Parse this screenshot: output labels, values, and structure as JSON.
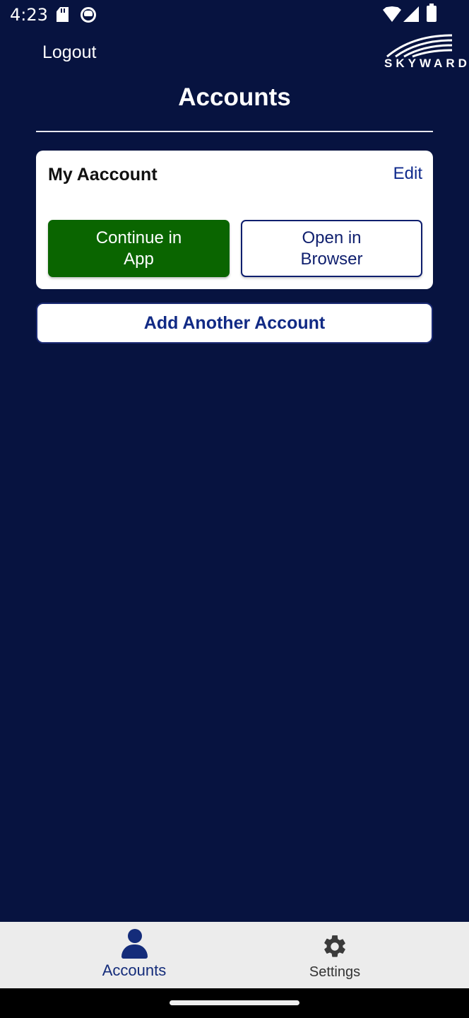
{
  "status_bar": {
    "time": "4:23",
    "icons": [
      "sd-card-icon",
      "cat-icon",
      "wifi-icon",
      "signal-icon",
      "battery-icon"
    ]
  },
  "header": {
    "logout_label": "Logout",
    "logo_text": "SKYWARD",
    "logo_registered": "®",
    "title": "Accounts"
  },
  "account_card": {
    "name": "My Aaccount",
    "edit_label": "Edit",
    "continue_label": "Continue in App",
    "browser_label": "Open in Browser"
  },
  "add_account_label": "Add Another Account",
  "bottom_nav": {
    "items": [
      {
        "label": "Accounts",
        "icon": "person-icon",
        "active": true
      },
      {
        "label": "Settings",
        "icon": "gear-icon",
        "active": false
      }
    ]
  },
  "colors": {
    "background": "#071340",
    "primary_text": "#112a85",
    "continue_button": "#0a6500",
    "nav_background": "#ececec"
  }
}
